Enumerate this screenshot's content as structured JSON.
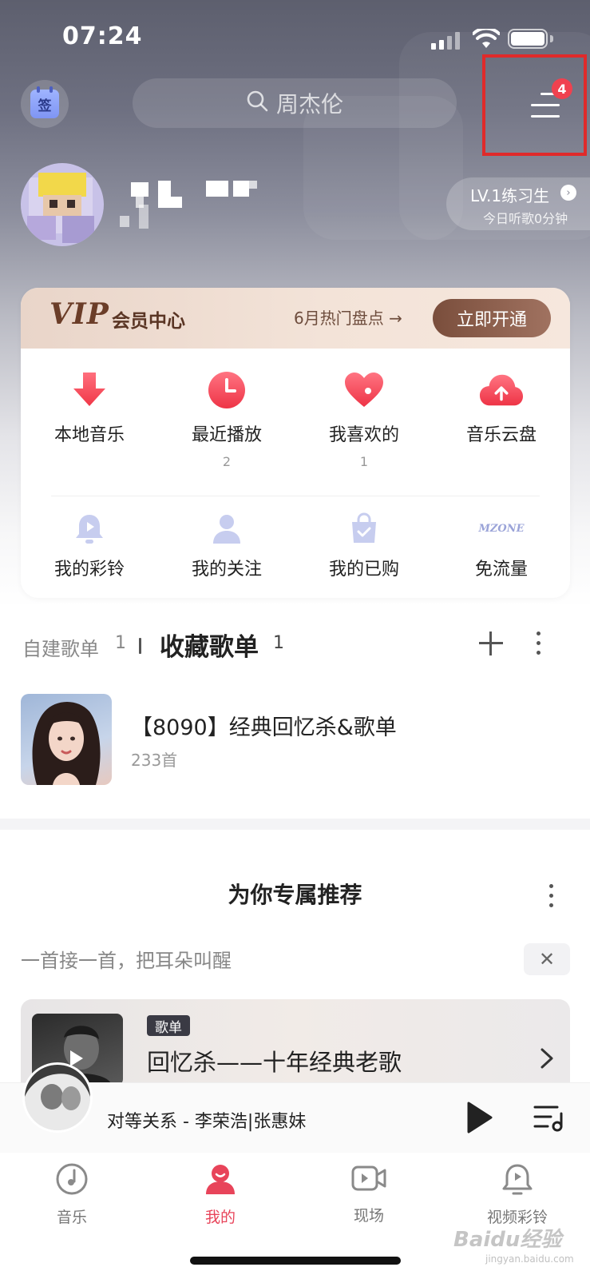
{
  "status_bar": {
    "time": "07:24"
  },
  "header": {
    "checkin_label": "签",
    "search_placeholder": "周杰伦",
    "menu_badge": "4"
  },
  "profile": {
    "level": "LV.1练习生",
    "listen_today": "今日听歌0分钟"
  },
  "vip": {
    "logo": "VIP",
    "center_label": "会员中心",
    "promo": "6月热门盘点 →",
    "open_button": "立即开通"
  },
  "quick_grid": {
    "row1": [
      {
        "label": "本地音乐",
        "count": "",
        "icon": "download-arrow-icon"
      },
      {
        "label": "最近播放",
        "count": "2",
        "icon": "clock-icon"
      },
      {
        "label": "我喜欢的",
        "count": "1",
        "icon": "heart-icon"
      },
      {
        "label": "音乐云盘",
        "count": "",
        "icon": "cloud-upload-icon"
      }
    ],
    "row2": [
      {
        "label": "我的彩铃",
        "icon": "ringtone-bell-icon"
      },
      {
        "label": "我的关注",
        "icon": "person-icon"
      },
      {
        "label": "我的已购",
        "icon": "shopping-bag-icon"
      },
      {
        "label": "免流量",
        "icon": "mzone-icon",
        "icon_text": "MZONE"
      }
    ]
  },
  "playlists": {
    "tab_created": "自建歌单",
    "tab_created_count": "1",
    "tab_collected": "收藏歌单",
    "tab_collected_count": "1",
    "items": [
      {
        "title": "【8090】经典回忆杀&歌单",
        "subtitle": "233首"
      }
    ]
  },
  "recommend": {
    "title": "为你专属推荐",
    "subtitle": "一首接一首，把耳朵叫醒",
    "card": {
      "tag": "歌单",
      "name": "回忆杀——十年经典老歌"
    }
  },
  "player": {
    "song": "对等关系 - 李荣浩|张惠妹"
  },
  "tabbar": [
    {
      "label": "音乐"
    },
    {
      "label": "我的"
    },
    {
      "label": "现场"
    },
    {
      "label": "视频彩铃"
    }
  ],
  "colors": {
    "accent": "#e8445a",
    "vip_brown": "#7a4e3c",
    "highlight_frame": "#e02a2a"
  },
  "watermark": {
    "brand": "Baidu经验",
    "site": "jingyan.baidu.com"
  }
}
